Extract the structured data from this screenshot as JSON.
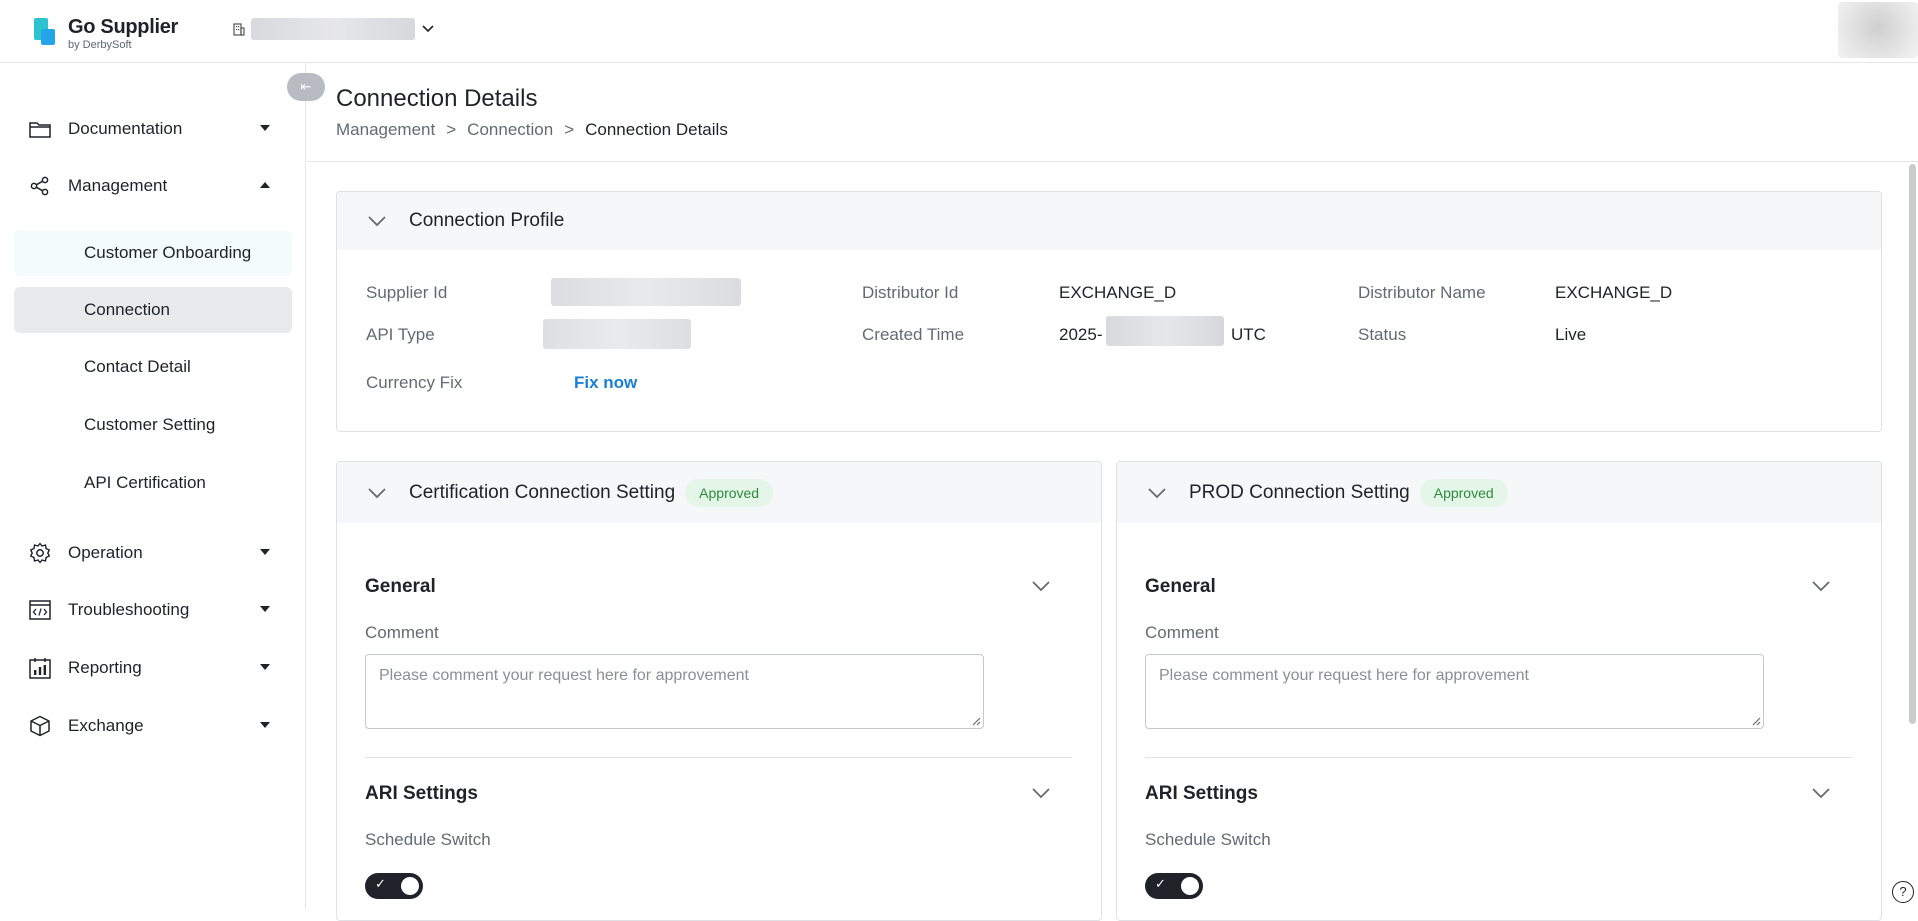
{
  "app": {
    "title": "Go Supplier",
    "subtitle": "by DerbySoft",
    "brand_colors": [
      "#2bc3cf",
      "#23a6e8"
    ]
  },
  "sidebar": {
    "items": [
      {
        "label": "Documentation",
        "icon": "folder-icon",
        "expanded": false
      },
      {
        "label": "Management",
        "icon": "share-nodes-icon",
        "expanded": true,
        "children": [
          {
            "label": "Customer Onboarding"
          },
          {
            "label": "Connection",
            "active": true
          },
          {
            "label": "Contact Detail"
          },
          {
            "label": "Customer Setting"
          },
          {
            "label": "API Certification"
          }
        ]
      },
      {
        "label": "Operation",
        "icon": "gear-icon",
        "expanded": false
      },
      {
        "label": "Troubleshooting",
        "icon": "code-window-icon",
        "expanded": false
      },
      {
        "label": "Reporting",
        "icon": "bar-chart-calendar-icon",
        "expanded": false
      },
      {
        "label": "Exchange",
        "icon": "cube-icon",
        "expanded": false
      }
    ]
  },
  "page": {
    "title": "Connection Details",
    "breadcrumb": [
      "Management",
      "Connection",
      "Connection Details"
    ],
    "breadcrumb_sep": ">"
  },
  "profile": {
    "title": "Connection Profile",
    "fields": {
      "supplier_id_label": "Supplier Id",
      "api_type_label": "API Type",
      "currency_fix_label": "Currency Fix",
      "currency_fix_action": "Fix now",
      "distributor_id_label": "Distributor Id",
      "distributor_id_value": "EXCHANGE_D",
      "created_time_label": "Created Time",
      "created_time_prefix": "2025-",
      "created_time_suffix": "UTC",
      "distributor_name_label": "Distributor Name",
      "distributor_name_value": "EXCHANGE_D",
      "status_label": "Status",
      "status_value": "Live"
    }
  },
  "cert_setting": {
    "title": "Certification Connection Setting",
    "badge": "Approved",
    "general_title": "General",
    "comment_label": "Comment",
    "comment_placeholder": "Please comment your request here for approvement",
    "ari_title": "ARI Settings",
    "schedule_label": "Schedule Switch",
    "schedule_on": true
  },
  "prod_setting": {
    "title": "PROD Connection Setting",
    "badge": "Approved",
    "general_title": "General",
    "comment_label": "Comment",
    "comment_placeholder": "Please comment your request here for approvement",
    "ari_title": "ARI Settings",
    "schedule_label": "Schedule Switch",
    "schedule_on": true
  },
  "help": {
    "label": "?"
  },
  "collapse": {
    "label": "⇤"
  }
}
